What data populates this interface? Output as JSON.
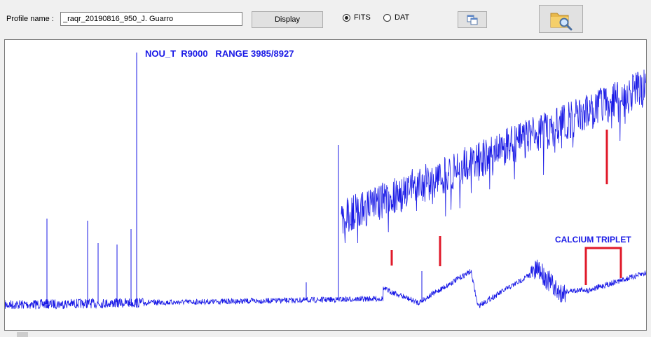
{
  "toolbar": {
    "profile_label": "Profile name :",
    "profile_value": "_raqr_20190816_950_J. Guarro",
    "display_label": "Display",
    "format_options": [
      "FITS",
      "DAT"
    ],
    "format_selected": "FITS",
    "copy_icon": "copy-windows-icon",
    "browse_icon": "folder-search-icon"
  },
  "chart_data": {
    "type": "line",
    "title": "NOU_T  R9000   RANGE 3985/8927",
    "annotation": "CALCIUM TRIPLET",
    "colors": {
      "spectrum": "#1a1ae6",
      "marker": "#e01a2a"
    },
    "grid": false
  }
}
